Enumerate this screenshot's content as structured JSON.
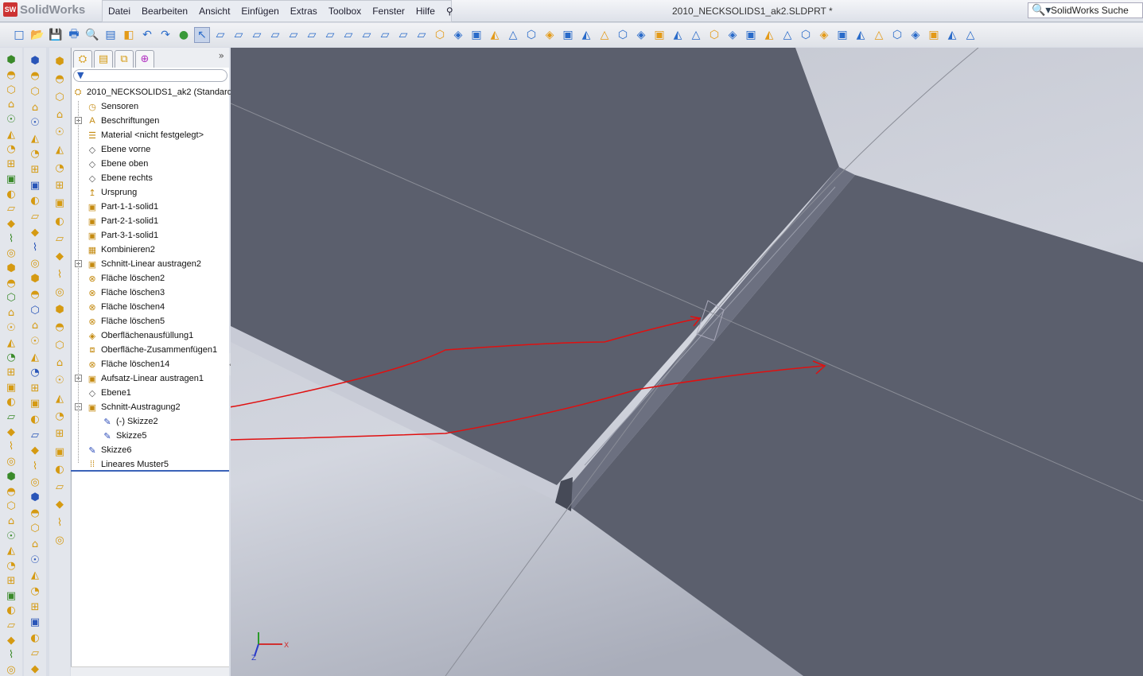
{
  "app": {
    "logo": "SolidWorks",
    "doc_title": "2010_NECKSOLIDS1_ak2.SLDPRT *",
    "search_placeholder": "SolidWorks Suche"
  },
  "menu": [
    "Datei",
    "Bearbeiten",
    "Ansicht",
    "Einfügen",
    "Extras",
    "Toolbox",
    "Fenster",
    "Hilfe"
  ],
  "tree": {
    "filter_icon": "funnel-icon",
    "root": "2010_NECKSOLIDS1_ak2  (Standard<",
    "items": [
      {
        "label": "Sensoren",
        "icon": "sensor-icon",
        "expand": false,
        "indent": 0
      },
      {
        "label": "Beschriftungen",
        "icon": "annotation-icon",
        "expand": true,
        "indent": 0
      },
      {
        "label": "Material <nicht festgelegt>",
        "icon": "material-icon",
        "expand": false,
        "indent": 0
      },
      {
        "label": "Ebene vorne",
        "icon": "plane-icon",
        "expand": false,
        "indent": 0
      },
      {
        "label": "Ebene oben",
        "icon": "plane-icon",
        "expand": false,
        "indent": 0
      },
      {
        "label": "Ebene rechts",
        "icon": "plane-icon",
        "expand": false,
        "indent": 0
      },
      {
        "label": "Ursprung",
        "icon": "origin-icon",
        "expand": false,
        "indent": 0
      },
      {
        "label": "Part-1-1-solid1",
        "icon": "part-icon",
        "expand": false,
        "indent": 0
      },
      {
        "label": "Part-2-1-solid1",
        "icon": "part-icon",
        "expand": false,
        "indent": 0
      },
      {
        "label": "Part-3-1-solid1",
        "icon": "part-icon",
        "expand": false,
        "indent": 0
      },
      {
        "label": "Kombinieren2",
        "icon": "combine-icon",
        "expand": false,
        "indent": 0
      },
      {
        "label": "Schnitt-Linear austragen2",
        "icon": "cut-extrude-icon",
        "expand": true,
        "indent": 0
      },
      {
        "label": "Fläche löschen2",
        "icon": "delete-face-icon",
        "expand": false,
        "indent": 0
      },
      {
        "label": "Fläche löschen3",
        "icon": "delete-face-icon",
        "expand": false,
        "indent": 0
      },
      {
        "label": "Fläche löschen4",
        "icon": "delete-face-icon",
        "expand": false,
        "indent": 0
      },
      {
        "label": "Fläche löschen5",
        "icon": "delete-face-icon",
        "expand": false,
        "indent": 0
      },
      {
        "label": "Oberflächenausfüllung1",
        "icon": "surface-fill-icon",
        "expand": false,
        "indent": 0
      },
      {
        "label": "Oberfläche-Zusammenfügen1",
        "icon": "surface-knit-icon",
        "expand": false,
        "indent": 0
      },
      {
        "label": "Fläche löschen14",
        "icon": "delete-face-icon",
        "expand": false,
        "indent": 0
      },
      {
        "label": "Aufsatz-Linear austragen1",
        "icon": "boss-extrude-icon",
        "expand": true,
        "indent": 0
      },
      {
        "label": "Ebene1",
        "icon": "plane-icon",
        "expand": false,
        "indent": 0
      },
      {
        "label": "Schnitt-Austragung2",
        "icon": "cut-sweep-icon",
        "expand": "minus",
        "indent": 0
      },
      {
        "label": "(-) Skizze2",
        "icon": "sketch-icon",
        "expand": false,
        "indent": 1
      },
      {
        "label": "Skizze5",
        "icon": "sketch-icon",
        "expand": false,
        "indent": 1
      },
      {
        "label": "Skizze6",
        "icon": "sketch-icon",
        "expand": false,
        "indent": 0
      },
      {
        "label": "Lineares Muster5",
        "icon": "linear-pattern-icon",
        "expand": false,
        "indent": 0
      }
    ]
  },
  "triad": {
    "x": "X",
    "y": "Y",
    "z": "Z"
  },
  "colors": {
    "annotation": "#e01010",
    "body": "#5b5f6d",
    "background": "#c9ccd6"
  }
}
